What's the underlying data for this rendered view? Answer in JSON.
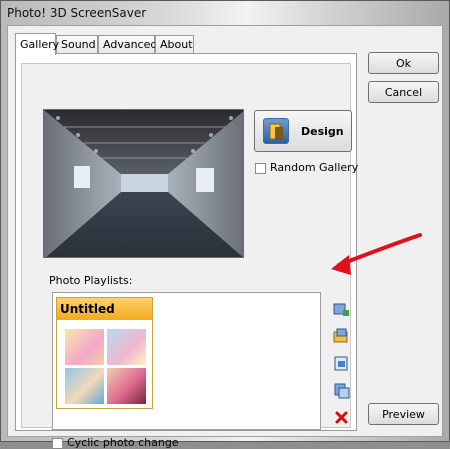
{
  "window": {
    "title": "Photo! 3D ScreenSaver"
  },
  "tabs": [
    {
      "label": "Gallery",
      "active": true
    },
    {
      "label": "Sound",
      "active": false
    },
    {
      "label": "Advanced",
      "active": false
    },
    {
      "label": "About",
      "active": false
    }
  ],
  "gallery": {
    "design_label": "Design",
    "random_gallery_label": "Random Gallery",
    "random_gallery_checked": false,
    "playlists_label": "Photo Playlists:",
    "playlists": [
      {
        "name": "Untitled"
      }
    ],
    "cyclic_label": "Cyclic photo change",
    "cyclic_checked": false,
    "side_icons": [
      "add-playlist-icon",
      "import-playlist-icon",
      "edit-playlist-icon",
      "copy-playlist-icon",
      "delete-icon"
    ]
  },
  "buttons": {
    "ok": "Ok",
    "cancel": "Cancel",
    "preview": "Preview"
  },
  "colors": {
    "accent_orange": "#f2a91e",
    "arrow_red": "#e0101c",
    "delete_red": "#d01010"
  }
}
